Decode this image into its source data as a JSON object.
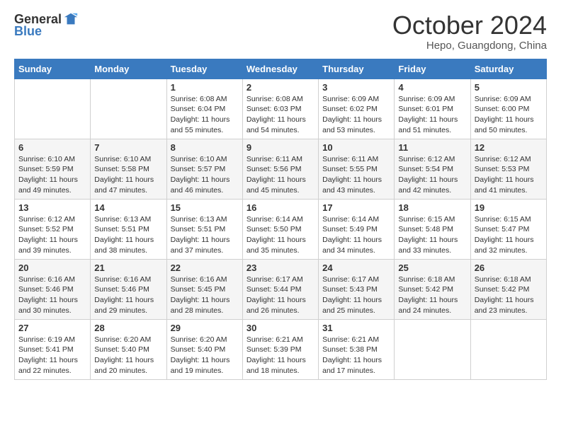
{
  "header": {
    "logo_general": "General",
    "logo_blue": "Blue",
    "title": "October 2024",
    "subtitle": "Hepo, Guangdong, China"
  },
  "days_of_week": [
    "Sunday",
    "Monday",
    "Tuesday",
    "Wednesday",
    "Thursday",
    "Friday",
    "Saturday"
  ],
  "weeks": [
    [
      {
        "day": "",
        "info": ""
      },
      {
        "day": "",
        "info": ""
      },
      {
        "day": "1",
        "info": "Sunrise: 6:08 AM\nSunset: 6:04 PM\nDaylight: 11 hours and 55 minutes."
      },
      {
        "day": "2",
        "info": "Sunrise: 6:08 AM\nSunset: 6:03 PM\nDaylight: 11 hours and 54 minutes."
      },
      {
        "day": "3",
        "info": "Sunrise: 6:09 AM\nSunset: 6:02 PM\nDaylight: 11 hours and 53 minutes."
      },
      {
        "day": "4",
        "info": "Sunrise: 6:09 AM\nSunset: 6:01 PM\nDaylight: 11 hours and 51 minutes."
      },
      {
        "day": "5",
        "info": "Sunrise: 6:09 AM\nSunset: 6:00 PM\nDaylight: 11 hours and 50 minutes."
      }
    ],
    [
      {
        "day": "6",
        "info": "Sunrise: 6:10 AM\nSunset: 5:59 PM\nDaylight: 11 hours and 49 minutes."
      },
      {
        "day": "7",
        "info": "Sunrise: 6:10 AM\nSunset: 5:58 PM\nDaylight: 11 hours and 47 minutes."
      },
      {
        "day": "8",
        "info": "Sunrise: 6:10 AM\nSunset: 5:57 PM\nDaylight: 11 hours and 46 minutes."
      },
      {
        "day": "9",
        "info": "Sunrise: 6:11 AM\nSunset: 5:56 PM\nDaylight: 11 hours and 45 minutes."
      },
      {
        "day": "10",
        "info": "Sunrise: 6:11 AM\nSunset: 5:55 PM\nDaylight: 11 hours and 43 minutes."
      },
      {
        "day": "11",
        "info": "Sunrise: 6:12 AM\nSunset: 5:54 PM\nDaylight: 11 hours and 42 minutes."
      },
      {
        "day": "12",
        "info": "Sunrise: 6:12 AM\nSunset: 5:53 PM\nDaylight: 11 hours and 41 minutes."
      }
    ],
    [
      {
        "day": "13",
        "info": "Sunrise: 6:12 AM\nSunset: 5:52 PM\nDaylight: 11 hours and 39 minutes."
      },
      {
        "day": "14",
        "info": "Sunrise: 6:13 AM\nSunset: 5:51 PM\nDaylight: 11 hours and 38 minutes."
      },
      {
        "day": "15",
        "info": "Sunrise: 6:13 AM\nSunset: 5:51 PM\nDaylight: 11 hours and 37 minutes."
      },
      {
        "day": "16",
        "info": "Sunrise: 6:14 AM\nSunset: 5:50 PM\nDaylight: 11 hours and 35 minutes."
      },
      {
        "day": "17",
        "info": "Sunrise: 6:14 AM\nSunset: 5:49 PM\nDaylight: 11 hours and 34 minutes."
      },
      {
        "day": "18",
        "info": "Sunrise: 6:15 AM\nSunset: 5:48 PM\nDaylight: 11 hours and 33 minutes."
      },
      {
        "day": "19",
        "info": "Sunrise: 6:15 AM\nSunset: 5:47 PM\nDaylight: 11 hours and 32 minutes."
      }
    ],
    [
      {
        "day": "20",
        "info": "Sunrise: 6:16 AM\nSunset: 5:46 PM\nDaylight: 11 hours and 30 minutes."
      },
      {
        "day": "21",
        "info": "Sunrise: 6:16 AM\nSunset: 5:46 PM\nDaylight: 11 hours and 29 minutes."
      },
      {
        "day": "22",
        "info": "Sunrise: 6:16 AM\nSunset: 5:45 PM\nDaylight: 11 hours and 28 minutes."
      },
      {
        "day": "23",
        "info": "Sunrise: 6:17 AM\nSunset: 5:44 PM\nDaylight: 11 hours and 26 minutes."
      },
      {
        "day": "24",
        "info": "Sunrise: 6:17 AM\nSunset: 5:43 PM\nDaylight: 11 hours and 25 minutes."
      },
      {
        "day": "25",
        "info": "Sunrise: 6:18 AM\nSunset: 5:42 PM\nDaylight: 11 hours and 24 minutes."
      },
      {
        "day": "26",
        "info": "Sunrise: 6:18 AM\nSunset: 5:42 PM\nDaylight: 11 hours and 23 minutes."
      }
    ],
    [
      {
        "day": "27",
        "info": "Sunrise: 6:19 AM\nSunset: 5:41 PM\nDaylight: 11 hours and 22 minutes."
      },
      {
        "day": "28",
        "info": "Sunrise: 6:20 AM\nSunset: 5:40 PM\nDaylight: 11 hours and 20 minutes."
      },
      {
        "day": "29",
        "info": "Sunrise: 6:20 AM\nSunset: 5:40 PM\nDaylight: 11 hours and 19 minutes."
      },
      {
        "day": "30",
        "info": "Sunrise: 6:21 AM\nSunset: 5:39 PM\nDaylight: 11 hours and 18 minutes."
      },
      {
        "day": "31",
        "info": "Sunrise: 6:21 AM\nSunset: 5:38 PM\nDaylight: 11 hours and 17 minutes."
      },
      {
        "day": "",
        "info": ""
      },
      {
        "day": "",
        "info": ""
      }
    ]
  ]
}
